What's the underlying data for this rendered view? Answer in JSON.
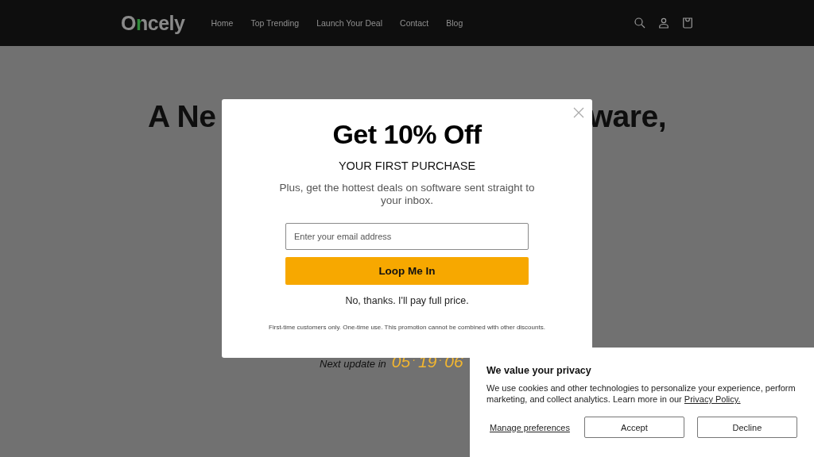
{
  "header": {
    "logo": "Oncely",
    "nav": [
      {
        "label": "Home"
      },
      {
        "label": "Top Trending"
      },
      {
        "label": "Launch Your Deal"
      },
      {
        "label": "Contact"
      },
      {
        "label": "Blog"
      }
    ]
  },
  "hero": {
    "heading_left": "A Ne",
    "heading_right": "ware,",
    "timer_label": "Next update in",
    "timer": [
      "05",
      ":",
      "19",
      ":",
      "06"
    ]
  },
  "popup": {
    "title": "Get 10% Off",
    "subtitle": "YOUR FIRST PURCHASE",
    "text": "Plus, get the hottest deals on software sent straight to your inbox.",
    "email": {
      "placeholder": "Enter your email address"
    },
    "submit": "Loop Me In",
    "decline": "No, thanks. I'll pay full price.",
    "fine_print": "First-time customers only. One-time use. This promotion cannot be combined with other discounts."
  },
  "cookie_banner": {
    "title": "We value your privacy",
    "text": "We use cookies and other technologies to personalize your experience, perform marketing, and collect analytics. Learn more in our ",
    "link": "Privacy Policy.",
    "manage": "Manage preferences",
    "buttons": [
      {
        "label": "Accept"
      },
      {
        "label": "Decline"
      }
    ]
  }
}
